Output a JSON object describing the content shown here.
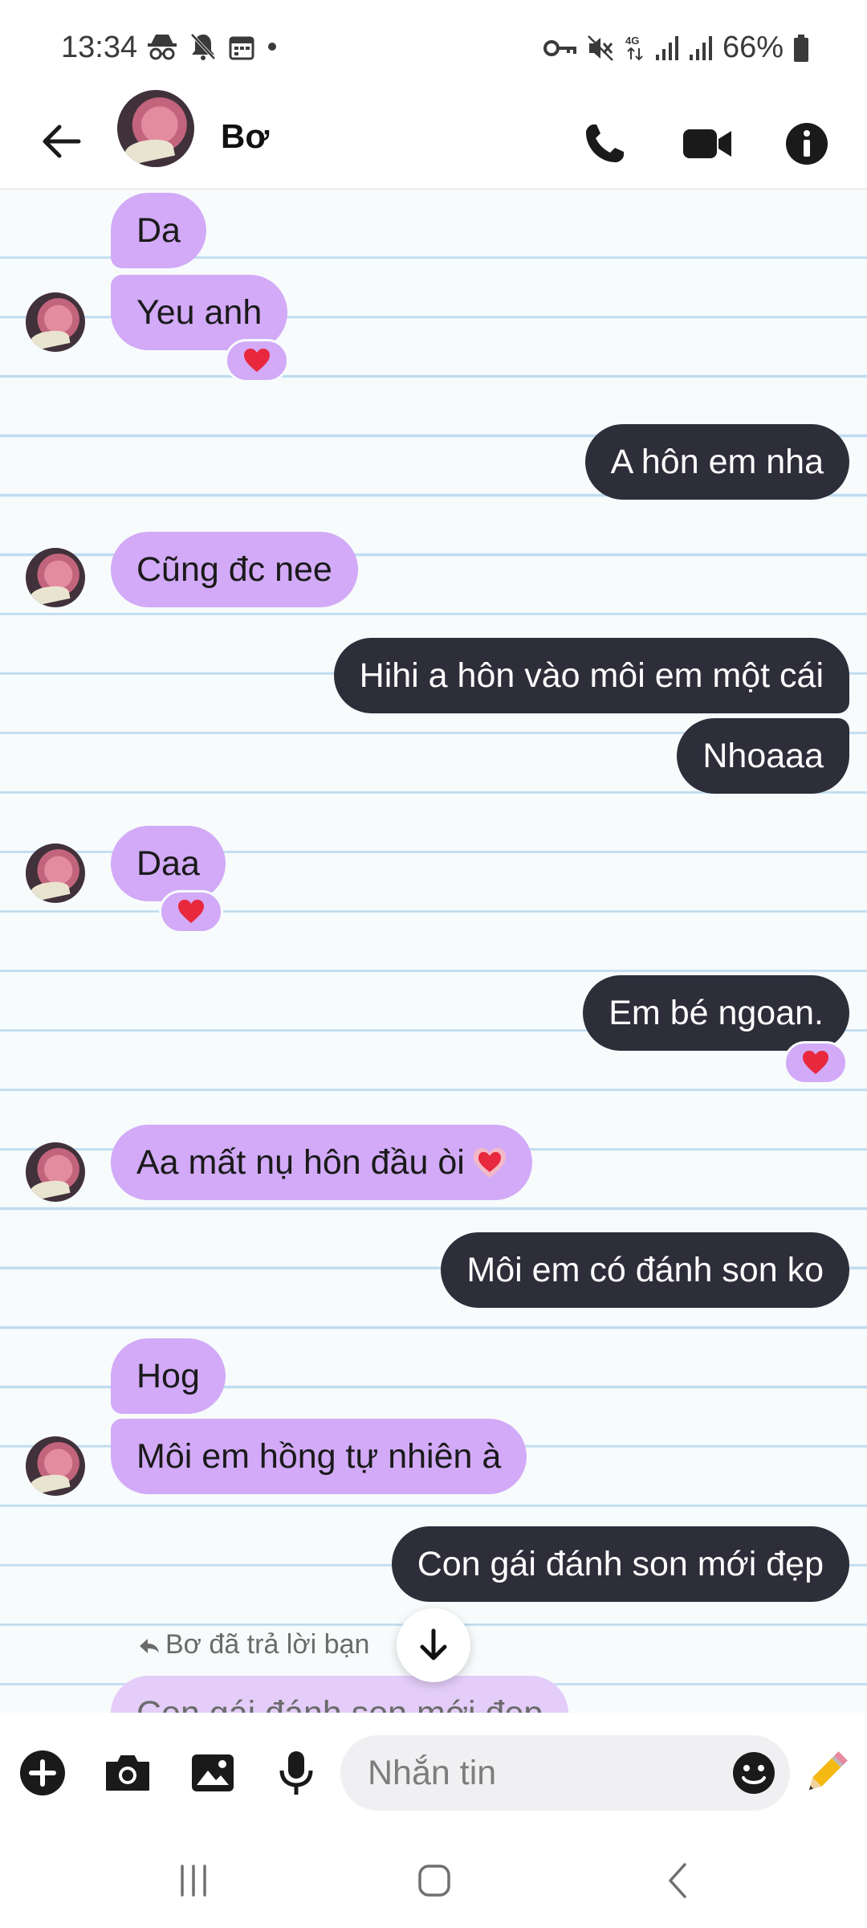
{
  "status_bar": {
    "time": "13:34",
    "battery": "66%"
  },
  "header": {
    "contact_name": "Bơ"
  },
  "messages": [
    {
      "text": "Da"
    },
    {
      "text": "Yeu anh"
    },
    {
      "text": "A hôn em nha"
    },
    {
      "text": "Cũng đc nee"
    },
    {
      "text": "Hihi a hôn vào môi em một cái"
    },
    {
      "text": "Nhoaaa"
    },
    {
      "text": "Daa"
    },
    {
      "text": "Em bé ngoan."
    },
    {
      "text": "Aa mất nụ hôn đầu òi"
    },
    {
      "text": "Môi em có đánh son ko"
    },
    {
      "text": "Hog"
    },
    {
      "text": "Môi em hồng tự nhiên à"
    },
    {
      "text": "Con gái đánh son mới đẹp"
    }
  ],
  "reply": {
    "label": "Bơ  đã trả lời bạn",
    "quoted": "Con gái đánh son mới đẹp"
  },
  "composer": {
    "placeholder": "Nhắn tin"
  },
  "colors": {
    "incoming_bubble": "#d2aaf7",
    "outgoing_bubble": "#2e2d3a",
    "reaction": "#e8283c"
  }
}
